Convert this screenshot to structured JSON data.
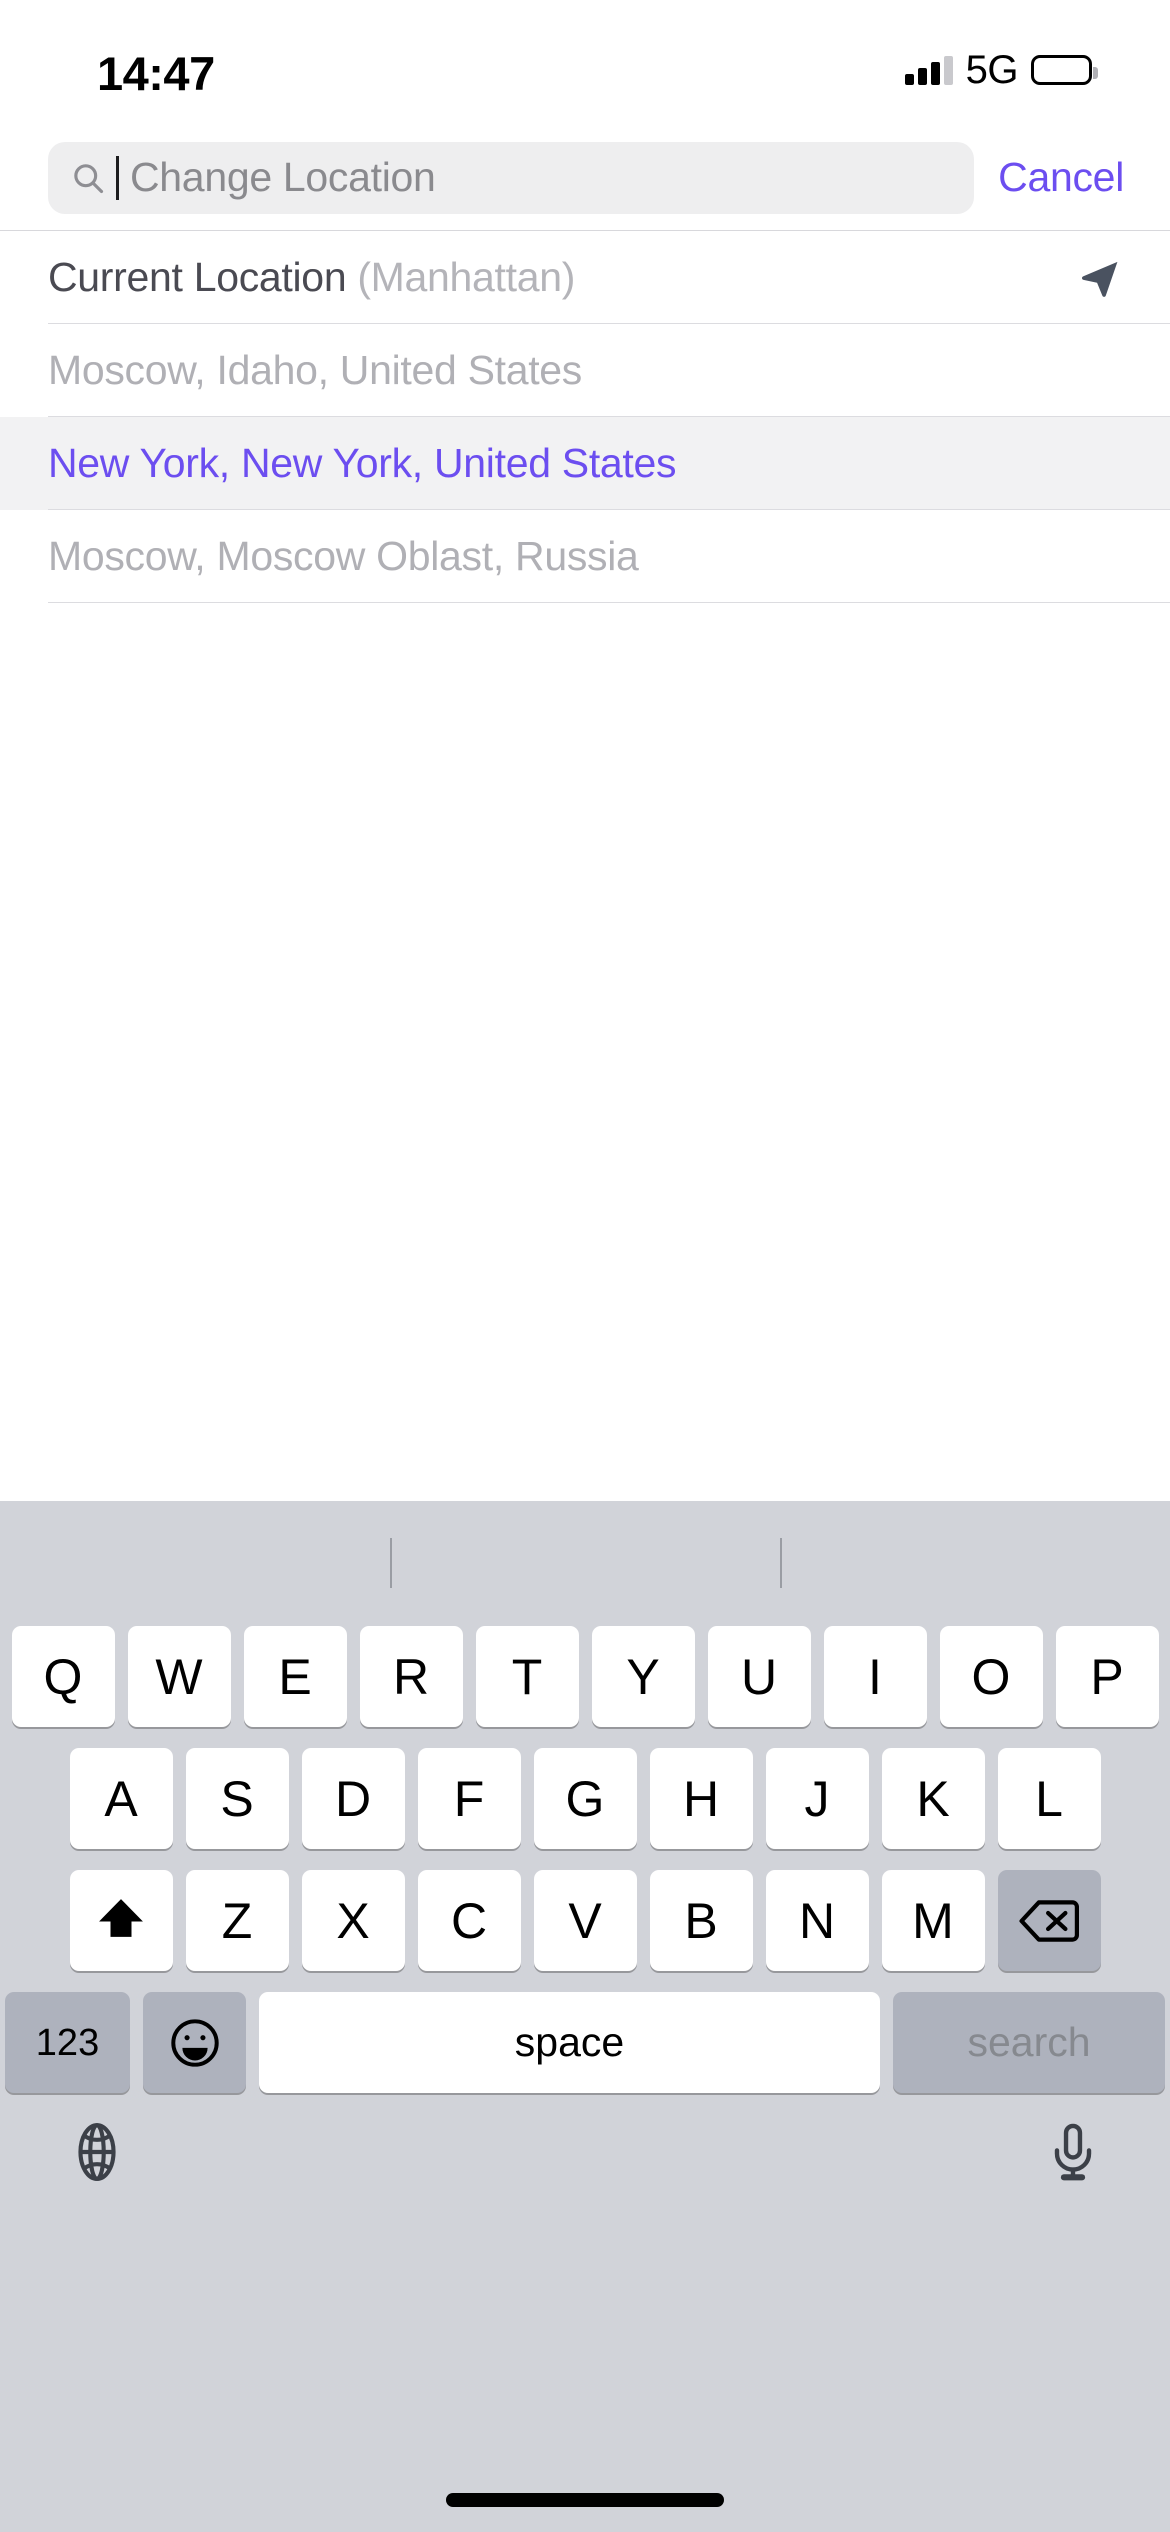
{
  "status_bar": {
    "time": "14:47",
    "network": "5G"
  },
  "search": {
    "placeholder": "Change Location",
    "value": "",
    "cancel_label": "Cancel"
  },
  "results": {
    "current_location": {
      "label": "Current Location",
      "detail": "(Manhattan)"
    },
    "items": [
      {
        "label": "Moscow, Idaho, United States",
        "selected": false
      },
      {
        "label": "New York, New York, United States",
        "selected": true
      },
      {
        "label": "Moscow, Moscow Oblast, Russia",
        "selected": false
      }
    ]
  },
  "keyboard": {
    "row1": [
      "Q",
      "W",
      "E",
      "R",
      "T",
      "Y",
      "U",
      "I",
      "O",
      "P"
    ],
    "row2": [
      "A",
      "S",
      "D",
      "F",
      "G",
      "H",
      "J",
      "K",
      "L"
    ],
    "row3": [
      "Z",
      "X",
      "C",
      "V",
      "B",
      "N",
      "M"
    ],
    "shift_label": "shift-key",
    "delete_label": "delete-key",
    "numbers_label": "123",
    "emoji_label": "emoji-key",
    "space_label": "space",
    "return_label": "search",
    "globe_label": "globe-key",
    "dictation_label": "dictation-key"
  },
  "colors": {
    "accent": "#6c4ef0",
    "keyboard_bg": "#d1d3d9",
    "key_bg": "#ffffff",
    "func_key_bg": "#aeb2bd",
    "selected_row_bg": "#f2f2f3"
  }
}
